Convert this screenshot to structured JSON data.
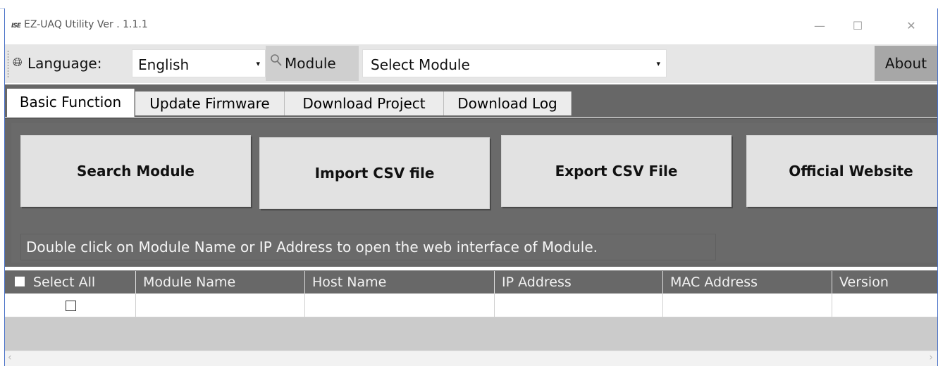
{
  "window": {
    "title": "EZ-UAQ Utility Ver . 1.1.1",
    "logo_text": "ISE",
    "minimize": "—",
    "maximize": "☐",
    "close": "✕"
  },
  "toolbar": {
    "language_icon": "globe-icon",
    "language_label": "Language:",
    "language_value": "English",
    "module_icon": "search-icon",
    "module_label": "Module",
    "module_value": "Select Module",
    "about_label": "About",
    "dropdown_arrow": "▾"
  },
  "tabs": [
    {
      "label": "Basic Function",
      "active": true
    },
    {
      "label": "Update Firmware",
      "active": false
    },
    {
      "label": "Download Project",
      "active": false
    },
    {
      "label": "Download Log",
      "active": false
    }
  ],
  "actions": {
    "search_module": "Search Module",
    "import_csv": "Import CSV file",
    "export_csv": "Export CSV File",
    "official_website": "Official Website"
  },
  "hint": "Double click on Module Name or IP Address to open the web interface of Module.",
  "grid": {
    "columns": [
      "Select All",
      "Module Name",
      "Host Name",
      "IP Address",
      "MAC Address",
      "Version"
    ],
    "rows": [
      {
        "selected": false,
        "module_name": "",
        "host_name": "",
        "ip_address": "",
        "mac_address": "",
        "version": ""
      }
    ]
  },
  "colors": {
    "panel_bg": "#676767",
    "toolbar_bg": "#e6e6e6",
    "button_bg": "#e2e2e2",
    "about_bg": "#a7a7a7"
  }
}
